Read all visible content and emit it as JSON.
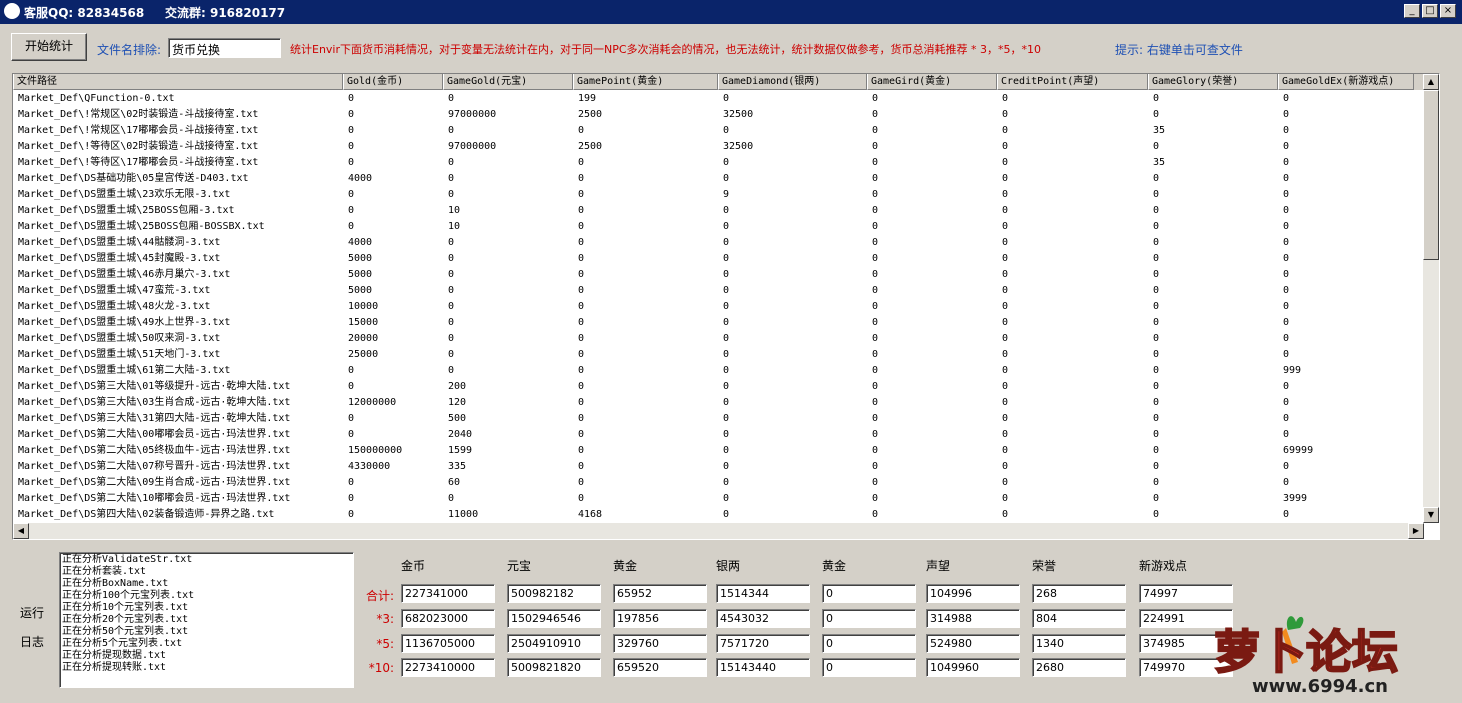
{
  "window": {
    "qq": "客服QQ: 82834568",
    "group": "交流群: 916820177",
    "min_glyph": "_",
    "max_glyph": "□",
    "close_glyph": "×"
  },
  "toolbar": {
    "start_label": "开始统计",
    "exclude_label": "文件名排除:",
    "exclude_value": "货币兑换",
    "notice": "统计Envir下面货币消耗情况，对于变量无法统计在内，对于同一NPC多次消耗会的情况，也无法统计，统计数据仅做参考，货币总消耗推荐 * 3，*5，*10",
    "hint": "提示: 右键单击可查文件"
  },
  "table": {
    "columns": [
      "文件路径",
      "Gold(金币)",
      "GameGold(元宝)",
      "GamePoint(黄金)",
      "GameDiamond(银两)",
      "GameGird(黄金)",
      "CreditPoint(声望)",
      "GameGlory(荣誉)",
      "GameGoldEx(新游戏点)"
    ],
    "rows": [
      [
        "Market_Def\\QFunction-0.txt",
        "0",
        "0",
        "199",
        "0",
        "0",
        "0",
        "0",
        "0"
      ],
      [
        "Market_Def\\!常规区\\02时装锻造-斗战接待室.txt",
        "0",
        "97000000",
        "2500",
        "32500",
        "0",
        "0",
        "0",
        "0"
      ],
      [
        "Market_Def\\!常规区\\17嘟嘟会员-斗战接待室.txt",
        "0",
        "0",
        "0",
        "0",
        "0",
        "0",
        "35",
        "0"
      ],
      [
        "Market_Def\\!等待区\\02时装锻造-斗战接待室.txt",
        "0",
        "97000000",
        "2500",
        "32500",
        "0",
        "0",
        "0",
        "0"
      ],
      [
        "Market_Def\\!等待区\\17嘟嘟会员-斗战接待室.txt",
        "0",
        "0",
        "0",
        "0",
        "0",
        "0",
        "35",
        "0"
      ],
      [
        "Market_Def\\DS基础功能\\05皇宫传送-D403.txt",
        "4000",
        "0",
        "0",
        "0",
        "0",
        "0",
        "0",
        "0"
      ],
      [
        "Market_Def\\DS盟重土城\\23欢乐无限-3.txt",
        "0",
        "0",
        "0",
        "9",
        "0",
        "0",
        "0",
        "0"
      ],
      [
        "Market_Def\\DS盟重土城\\25BOSS包厢-3.txt",
        "0",
        "10",
        "0",
        "0",
        "0",
        "0",
        "0",
        "0"
      ],
      [
        "Market_Def\\DS盟重土城\\25BOSS包厢-BOSSBX.txt",
        "0",
        "10",
        "0",
        "0",
        "0",
        "0",
        "0",
        "0"
      ],
      [
        "Market_Def\\DS盟重土城\\44骷髅洞-3.txt",
        "4000",
        "0",
        "0",
        "0",
        "0",
        "0",
        "0",
        "0"
      ],
      [
        "Market_Def\\DS盟重土城\\45封魔殿-3.txt",
        "5000",
        "0",
        "0",
        "0",
        "0",
        "0",
        "0",
        "0"
      ],
      [
        "Market_Def\\DS盟重土城\\46赤月巢穴-3.txt",
        "5000",
        "0",
        "0",
        "0",
        "0",
        "0",
        "0",
        "0"
      ],
      [
        "Market_Def\\DS盟重土城\\47蛮荒-3.txt",
        "5000",
        "0",
        "0",
        "0",
        "0",
        "0",
        "0",
        "0"
      ],
      [
        "Market_Def\\DS盟重土城\\48火龙-3.txt",
        "10000",
        "0",
        "0",
        "0",
        "0",
        "0",
        "0",
        "0"
      ],
      [
        "Market_Def\\DS盟重土城\\49水上世界-3.txt",
        "15000",
        "0",
        "0",
        "0",
        "0",
        "0",
        "0",
        "0"
      ],
      [
        "Market_Def\\DS盟重土城\\50叹来洞-3.txt",
        "20000",
        "0",
        "0",
        "0",
        "0",
        "0",
        "0",
        "0"
      ],
      [
        "Market_Def\\DS盟重土城\\51天地门-3.txt",
        "25000",
        "0",
        "0",
        "0",
        "0",
        "0",
        "0",
        "0"
      ],
      [
        "Market_Def\\DS盟重土城\\61第二大陆-3.txt",
        "0",
        "0",
        "0",
        "0",
        "0",
        "0",
        "0",
        "999"
      ],
      [
        "Market_Def\\DS第三大陆\\01等级提升-远古·乾坤大陆.txt",
        "0",
        "200",
        "0",
        "0",
        "0",
        "0",
        "0",
        "0"
      ],
      [
        "Market_Def\\DS第三大陆\\03生肖合成-远古·乾坤大陆.txt",
        "12000000",
        "120",
        "0",
        "0",
        "0",
        "0",
        "0",
        "0"
      ],
      [
        "Market_Def\\DS第三大陆\\31第四大陆-远古·乾坤大陆.txt",
        "0",
        "500",
        "0",
        "0",
        "0",
        "0",
        "0",
        "0"
      ],
      [
        "Market_Def\\DS第二大陆\\00嘟嘟会员-远古·玛法世界.txt",
        "0",
        "2040",
        "0",
        "0",
        "0",
        "0",
        "0",
        "0"
      ],
      [
        "Market_Def\\DS第二大陆\\05终极血牛-远古·玛法世界.txt",
        "150000000",
        "1599",
        "0",
        "0",
        "0",
        "0",
        "0",
        "69999"
      ],
      [
        "Market_Def\\DS第二大陆\\07称号晋升-远古·玛法世界.txt",
        "4330000",
        "335",
        "0",
        "0",
        "0",
        "0",
        "0",
        "0"
      ],
      [
        "Market_Def\\DS第二大陆\\09生肖合成-远古·玛法世界.txt",
        "0",
        "60",
        "0",
        "0",
        "0",
        "0",
        "0",
        "0"
      ],
      [
        "Market_Def\\DS第二大陆\\10嘟嘟会员-远古·玛法世界.txt",
        "0",
        "0",
        "0",
        "0",
        "0",
        "0",
        "0",
        "3999"
      ],
      [
        "Market_Def\\DS第四大陆\\02装备锻造师-异界之路.txt",
        "0",
        "11000",
        "4168",
        "0",
        "0",
        "0",
        "0",
        "0"
      ]
    ]
  },
  "log": {
    "label_run": "运行",
    "label_log": "日志",
    "lines": [
      "正在分析ValidateStr.txt",
      "正在分析套装.txt",
      "正在分析BoxName.txt",
      "正在分析100个元宝列表.txt",
      "正在分析10个元宝列表.txt",
      "正在分析20个元宝列表.txt",
      "正在分析50个元宝列表.txt",
      "正在分析5个元宝列表.txt",
      "正在分析提现数据.txt",
      "正在分析提现转账.txt"
    ]
  },
  "summary": {
    "headers": [
      "金币",
      "元宝",
      "黄金",
      "银两",
      "黄金",
      "声望",
      "荣誉",
      "新游戏点"
    ],
    "rows": [
      {
        "label": "合计:",
        "values": [
          "227341000",
          "500982182",
          "65952",
          "1514344",
          "0",
          "104996",
          "268",
          "74997"
        ]
      },
      {
        "label": "*3:",
        "values": [
          "682023000",
          "1502946546",
          "197856",
          "4543032",
          "0",
          "314988",
          "804",
          "224991"
        ]
      },
      {
        "label": "*5:",
        "values": [
          "1136705000",
          "2504910910",
          "329760",
          "7571720",
          "0",
          "524980",
          "1340",
          "374985"
        ]
      },
      {
        "label": "*10:",
        "values": [
          "2273410000",
          "5009821820",
          "659520",
          "15143440",
          "0",
          "1049960",
          "2680",
          "749970"
        ]
      }
    ]
  },
  "watermark": {
    "title": "萝卜论坛",
    "url": "www.6994.cn"
  },
  "colors": {
    "titlebar": "#0a246a",
    "notice": "#cc0000",
    "hint": "#1e50b4",
    "logo_red": "#e8342a"
  }
}
